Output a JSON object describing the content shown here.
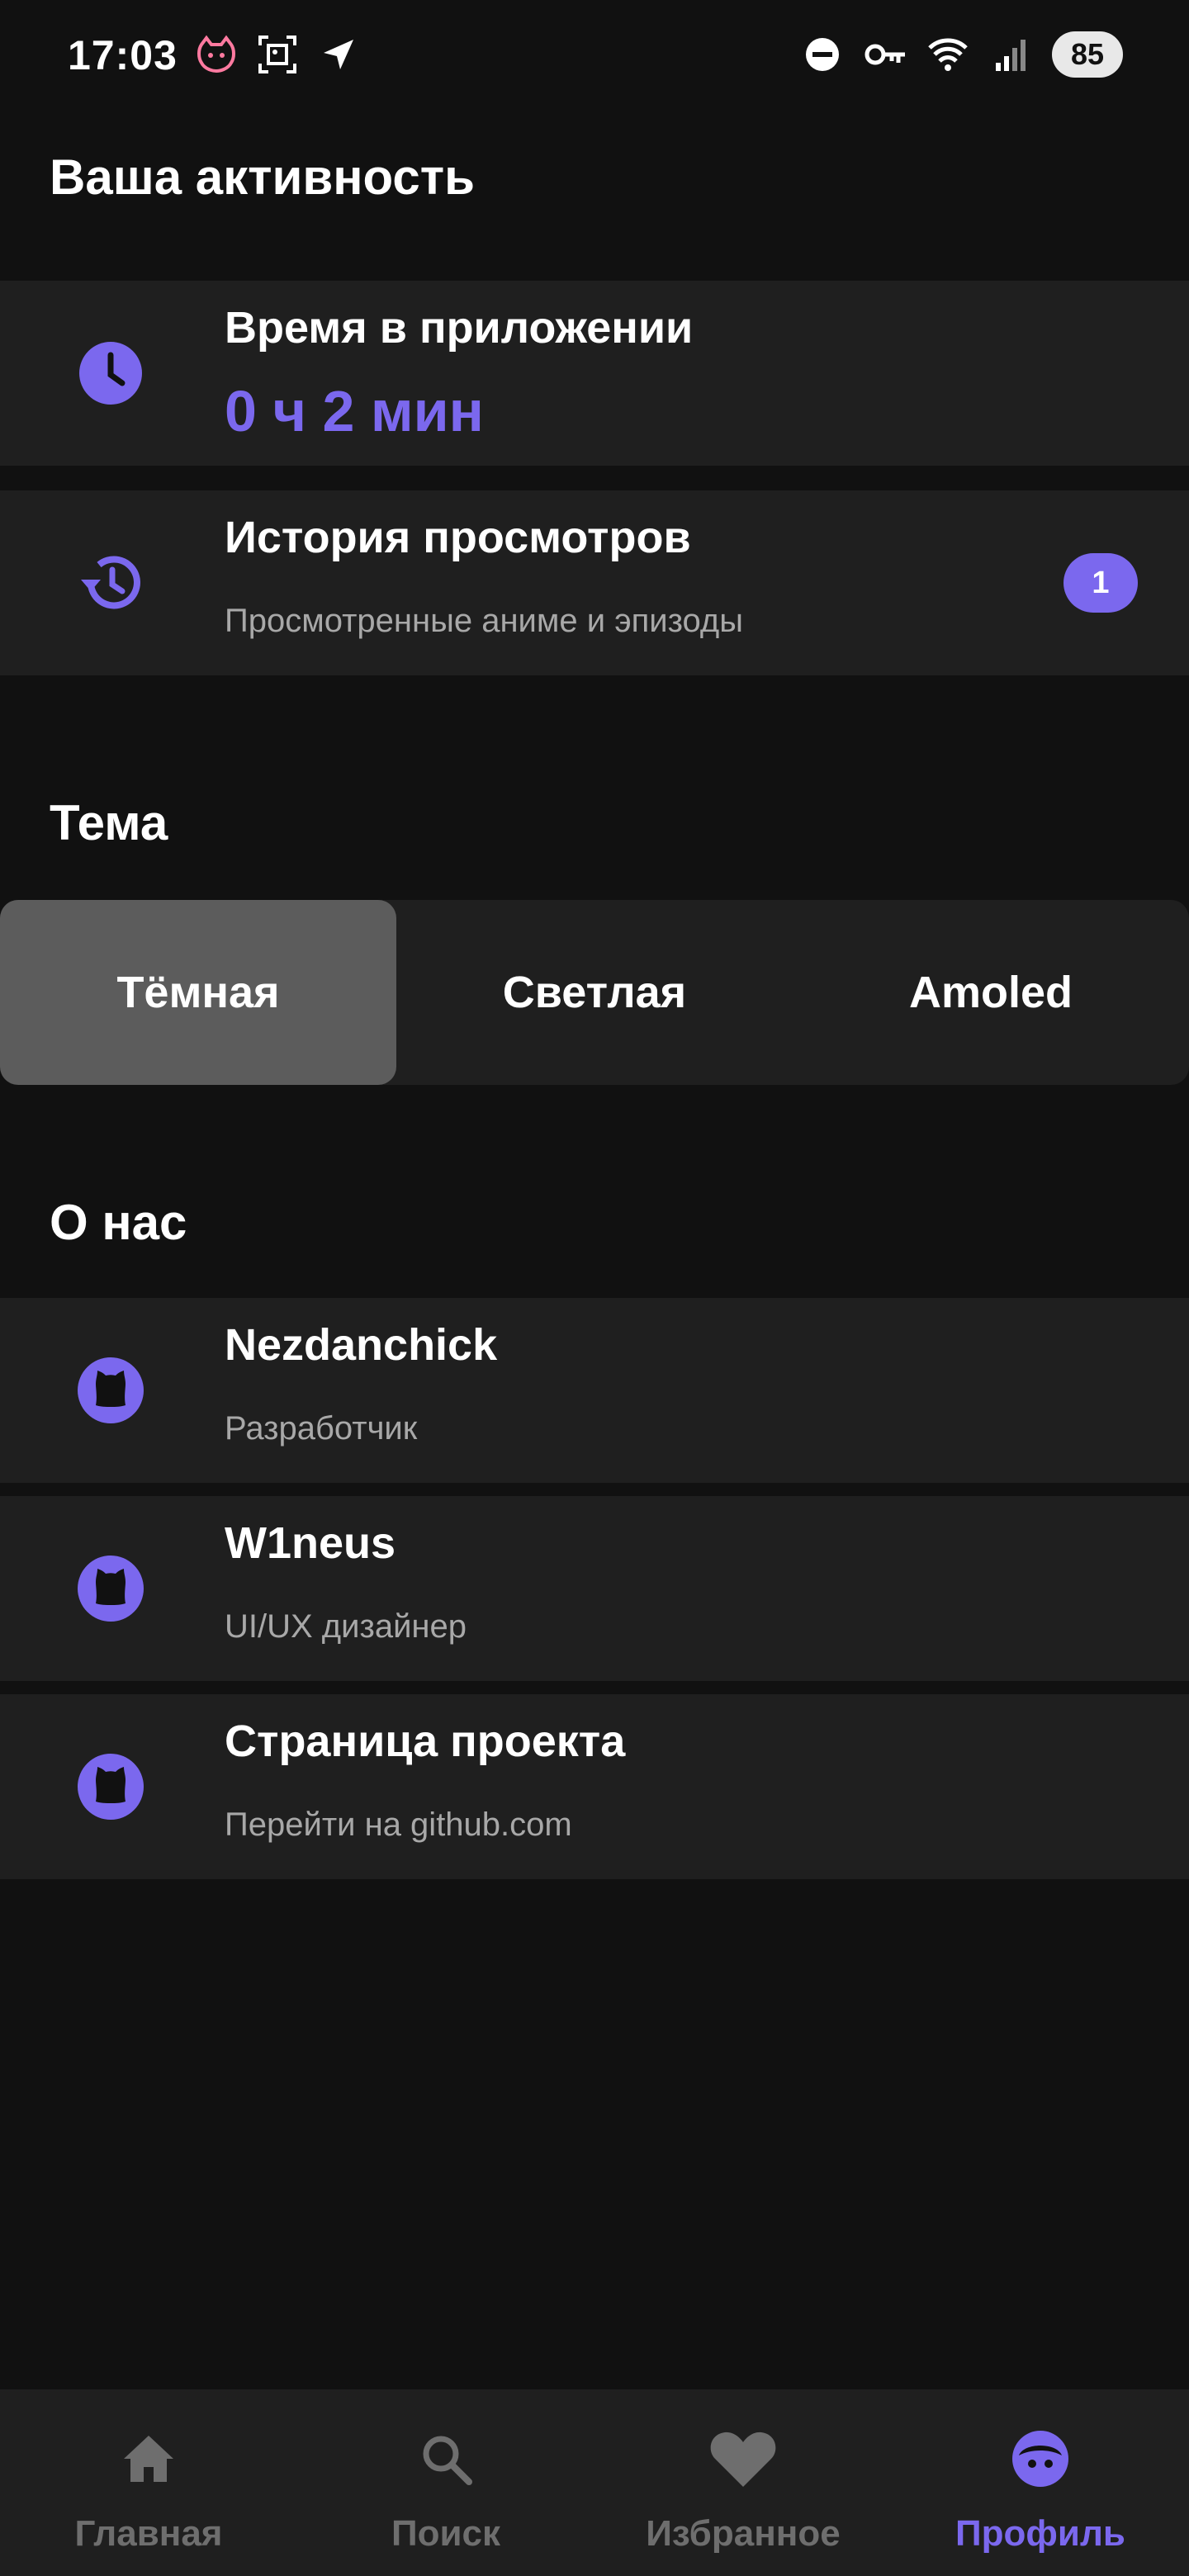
{
  "status_bar": {
    "time": "17:03",
    "battery": "85",
    "icons": [
      "cat-notification-icon",
      "screenshot-icon",
      "location-arrow-icon",
      "do-not-disturb-icon",
      "vpn-key-icon",
      "wifi-icon",
      "signal-icon"
    ]
  },
  "activity": {
    "section_title": "Ваша активность",
    "time_in_app": {
      "title": "Время в приложении",
      "value": "0 ч 2 мин",
      "icon": "clock-icon"
    },
    "history": {
      "title": "История просмотров",
      "subtitle": "Просмотренные аниме и эпизоды",
      "badge": "1",
      "icon": "history-icon"
    }
  },
  "theme": {
    "section_title": "Тема",
    "options": [
      "Тёмная",
      "Светлая",
      "Amoled"
    ],
    "selected": "Тёмная"
  },
  "about": {
    "section_title": "О нас",
    "items": [
      {
        "title": "Nezdanchick",
        "subtitle": "Разработчик",
        "icon": "github-icon"
      },
      {
        "title": "W1neus",
        "subtitle": "UI/UX дизайнер",
        "icon": "github-icon"
      },
      {
        "title": "Страница проекта",
        "subtitle": "Перейти на github.com",
        "icon": "github-icon"
      }
    ]
  },
  "bottom_nav": {
    "items": [
      {
        "label": "Главная",
        "icon": "home-icon"
      },
      {
        "label": "Поиск",
        "icon": "search-icon"
      },
      {
        "label": "Избранное",
        "icon": "heart-icon"
      },
      {
        "label": "Профиль",
        "icon": "profile-face-icon"
      }
    ],
    "active": "Профиль"
  },
  "colors": {
    "accent": "#7b68ee",
    "background": "#111111",
    "card": "#1f1f1f",
    "selected_segment": "#5c5c5c",
    "inactive_nav": "#6e6e6e"
  }
}
